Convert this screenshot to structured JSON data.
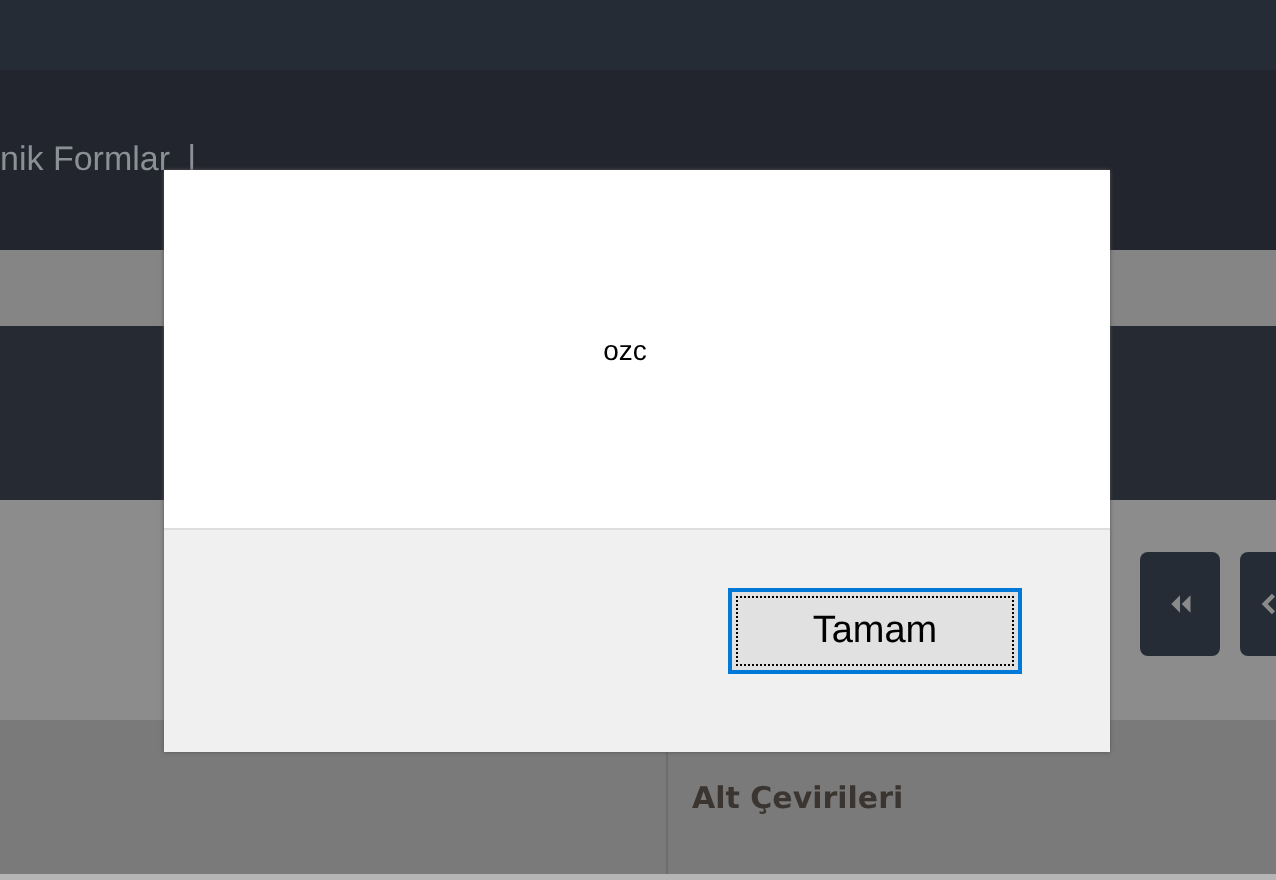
{
  "header": {
    "breadcrumb": "nik Formlar",
    "separator": "|"
  },
  "pager": [
    {
      "kind": "first"
    },
    {
      "kind": "previous"
    }
  ],
  "table": {
    "column_2": "Alt Çevirileri"
  },
  "dialog": {
    "message": "ozc",
    "button": {
      "label": "Tamam",
      "focused": true
    }
  }
}
